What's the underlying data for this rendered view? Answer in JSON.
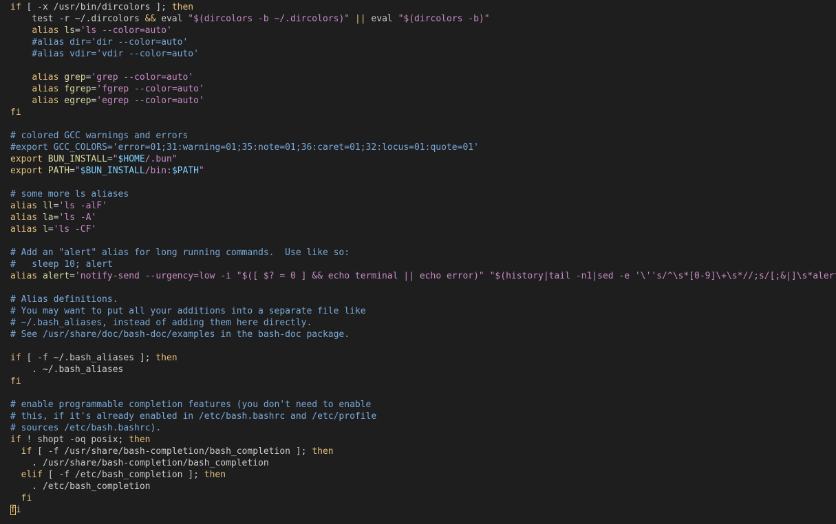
{
  "colors": {
    "default": "#cccccc",
    "comment": "#79aadb",
    "keyword": "#e5c07b",
    "string": "#c98ac7",
    "alias_name": "#d7d7a0",
    "variable": "#7dcfff",
    "cursor": "#e8c36a",
    "background": "#1e1e1e"
  },
  "lines": [
    [
      [
        "k",
        "if"
      ],
      [
        "d",
        " [ -x /usr/bin/dircolors ]; "
      ],
      [
        "k",
        "then"
      ]
    ],
    [
      [
        "d",
        "    test -r ~/.dircolors "
      ],
      [
        "k",
        "&&"
      ],
      [
        "d",
        " eval "
      ],
      [
        "s",
        "\"$(dircolors -b ~/.dircolors)\""
      ],
      [
        "d",
        " "
      ],
      [
        "k",
        "||"
      ],
      [
        "d",
        " eval "
      ],
      [
        "s",
        "\"$(dircolors -b)\""
      ]
    ],
    [
      [
        "d",
        "    "
      ],
      [
        "k",
        "alias"
      ],
      [
        "d",
        " "
      ],
      [
        "a",
        "ls"
      ],
      [
        "d",
        "="
      ],
      [
        "s",
        "'ls --color=auto'"
      ]
    ],
    [
      [
        "c",
        "    #alias dir='dir --color=auto'"
      ]
    ],
    [
      [
        "c",
        "    #alias vdir='vdir --color=auto'"
      ]
    ],
    [],
    [
      [
        "d",
        "    "
      ],
      [
        "k",
        "alias"
      ],
      [
        "d",
        " "
      ],
      [
        "a",
        "grep"
      ],
      [
        "d",
        "="
      ],
      [
        "s",
        "'grep --color=auto'"
      ]
    ],
    [
      [
        "d",
        "    "
      ],
      [
        "k",
        "alias"
      ],
      [
        "d",
        " "
      ],
      [
        "a",
        "fgrep"
      ],
      [
        "d",
        "="
      ],
      [
        "s",
        "'fgrep --color=auto'"
      ]
    ],
    [
      [
        "d",
        "    "
      ],
      [
        "k",
        "alias"
      ],
      [
        "d",
        " "
      ],
      [
        "a",
        "egrep"
      ],
      [
        "d",
        "="
      ],
      [
        "s",
        "'egrep --color=auto'"
      ]
    ],
    [
      [
        "k",
        "fi"
      ]
    ],
    [],
    [
      [
        "c",
        "# colored GCC warnings and errors"
      ]
    ],
    [
      [
        "c",
        "#export GCC_COLORS='error=01;31:warning=01;35:note=01;36:caret=01;32:locus=01:quote=01'"
      ]
    ],
    [
      [
        "k",
        "export"
      ],
      [
        "d",
        " "
      ],
      [
        "a",
        "BUN_INSTALL"
      ],
      [
        "d",
        "="
      ],
      [
        "s",
        "\""
      ],
      [
        "v",
        "$HOME"
      ],
      [
        "s",
        "/.bun\""
      ]
    ],
    [
      [
        "k",
        "export"
      ],
      [
        "d",
        " "
      ],
      [
        "a",
        "PATH"
      ],
      [
        "d",
        "="
      ],
      [
        "s",
        "\""
      ],
      [
        "v",
        "$BUN_INSTALL"
      ],
      [
        "s",
        "/bin:"
      ],
      [
        "v",
        "$PATH"
      ],
      [
        "s",
        "\""
      ]
    ],
    [],
    [
      [
        "c",
        "# some more ls aliases"
      ]
    ],
    [
      [
        "k",
        "alias"
      ],
      [
        "d",
        " "
      ],
      [
        "a",
        "ll"
      ],
      [
        "d",
        "="
      ],
      [
        "s",
        "'ls -alF'"
      ]
    ],
    [
      [
        "k",
        "alias"
      ],
      [
        "d",
        " "
      ],
      [
        "a",
        "la"
      ],
      [
        "d",
        "="
      ],
      [
        "s",
        "'ls -A'"
      ]
    ],
    [
      [
        "k",
        "alias"
      ],
      [
        "d",
        " "
      ],
      [
        "a",
        "l"
      ],
      [
        "d",
        "="
      ],
      [
        "s",
        "'ls -CF'"
      ]
    ],
    [],
    [
      [
        "c",
        "# Add an \"alert\" alias for long running commands.  Use like so:"
      ]
    ],
    [
      [
        "c",
        "#   sleep 10; alert"
      ]
    ],
    [
      [
        "k",
        "alias"
      ],
      [
        "d",
        " "
      ],
      [
        "a",
        "alert"
      ],
      [
        "d",
        "="
      ],
      [
        "s",
        "'notify-send --urgency=low -i \"$([ $? = 0 ] && echo terminal || echo error)\" \"$(history|tail -n1|sed -e '\\''s/^\\s*[0-9]\\+\\s*//;s/[;&|]\\s*alert$//'\\'')\"'"
      ]
    ],
    [],
    [
      [
        "c",
        "# Alias definitions."
      ]
    ],
    [
      [
        "c",
        "# You may want to put all your additions into a separate file like"
      ]
    ],
    [
      [
        "c",
        "# ~/.bash_aliases, instead of adding them here directly."
      ]
    ],
    [
      [
        "c",
        "# See /usr/share/doc/bash-doc/examples in the bash-doc package."
      ]
    ],
    [],
    [
      [
        "k",
        "if"
      ],
      [
        "d",
        " [ -f ~/.bash_aliases ]; "
      ],
      [
        "k",
        "then"
      ]
    ],
    [
      [
        "d",
        "    . ~/.bash_aliases"
      ]
    ],
    [
      [
        "k",
        "fi"
      ]
    ],
    [],
    [
      [
        "c",
        "# enable programmable completion features (you don't need to enable"
      ]
    ],
    [
      [
        "c",
        "# this, if it's already enabled in /etc/bash.bashrc and /etc/profile"
      ]
    ],
    [
      [
        "c",
        "# sources /etc/bash.bashrc)."
      ]
    ],
    [
      [
        "k",
        "if"
      ],
      [
        "d",
        " ! shopt -oq posix; "
      ],
      [
        "k",
        "then"
      ]
    ],
    [
      [
        "d",
        "  "
      ],
      [
        "k",
        "if"
      ],
      [
        "d",
        " [ -f /usr/share/bash-completion/bash_completion ]; "
      ],
      [
        "k",
        "then"
      ]
    ],
    [
      [
        "d",
        "    . /usr/share/bash-completion/bash_completion"
      ]
    ],
    [
      [
        "d",
        "  "
      ],
      [
        "k",
        "elif"
      ],
      [
        "d",
        " [ -f /etc/bash_completion ]; "
      ],
      [
        "k",
        "then"
      ]
    ],
    [
      [
        "d",
        "    . /etc/bash_completion"
      ]
    ],
    [
      [
        "d",
        "  "
      ],
      [
        "k",
        "fi"
      ]
    ],
    [
      [
        "cur",
        "f"
      ],
      [
        "k",
        "i"
      ]
    ]
  ]
}
